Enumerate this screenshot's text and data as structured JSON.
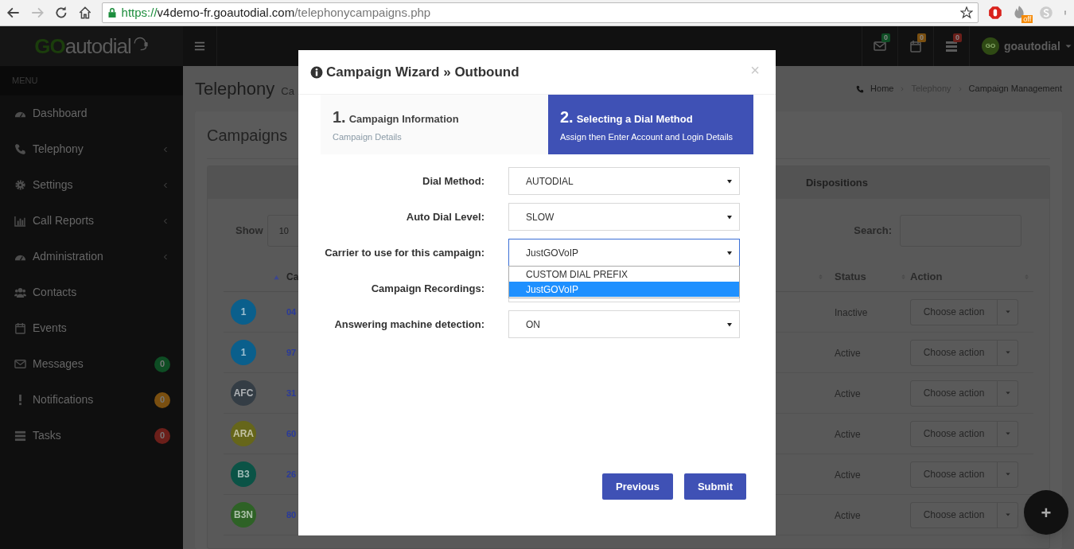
{
  "browser": {
    "url": {
      "scheme": "https://",
      "host": "v4demo-fr.goautodial.com",
      "path": "/telephonycampaigns.php"
    },
    "extension_badge": "off"
  },
  "header": {
    "logo": {
      "part_1": "GO",
      "part_2": "autodial"
    },
    "notifications": [
      {
        "kind": "mail",
        "count": "0",
        "color": "#0e4d24"
      },
      {
        "kind": "calendar",
        "count": "0",
        "color": "#7a4f10"
      },
      {
        "kind": "tasks",
        "count": "0",
        "color": "#6b1f1a"
      }
    ],
    "user": {
      "avatar": "GO",
      "name": "goautodial"
    }
  },
  "sidebar": {
    "heading": "MENU",
    "items": [
      {
        "kind": "dashboard",
        "label": "Dashboard",
        "expandable": false
      },
      {
        "kind": "phone",
        "label": "Telephony",
        "expandable": true
      },
      {
        "kind": "gear",
        "label": "Settings",
        "expandable": true
      },
      {
        "kind": "chart",
        "label": "Call Reports",
        "expandable": true
      },
      {
        "kind": "dashboard",
        "label": "Administration",
        "expandable": true
      },
      {
        "kind": "users",
        "label": "Contacts",
        "expandable": false
      },
      {
        "kind": "calendar",
        "label": "Events",
        "expandable": false
      },
      {
        "kind": "mail",
        "label": "Messages",
        "expandable": false,
        "badge": "0",
        "color": "#0e4d24"
      },
      {
        "kind": "exclamation",
        "label": "Notifications",
        "expandable": false,
        "badge": "0",
        "color": "#7a4f10"
      },
      {
        "kind": "tasks",
        "label": "Tasks",
        "expandable": false,
        "badge": "0",
        "color": "#6b1f1a"
      }
    ]
  },
  "page": {
    "title": "Telephony",
    "subtitle": "Ca",
    "breadcrumb": [
      "Home",
      "Telephony",
      "Campaign Management"
    ]
  },
  "card": {
    "title": "Campaigns",
    "tab": "Dispositions",
    "show_label": "Show",
    "show_value": "10",
    "search_label": "Search:",
    "columns": [
      {
        "label": "Ca",
        "sorted": true
      },
      {
        "label": "Status",
        "sorted": false
      },
      {
        "label": "Action",
        "sorted": false
      }
    ],
    "rows": [
      {
        "avatar": "1",
        "color": "#0a5f8c",
        "id": "04",
        "status": "Inactive",
        "action": "Choose action"
      },
      {
        "avatar": "1",
        "color": "#0a5f8c",
        "id": "97",
        "status": "Active",
        "action": "Choose action"
      },
      {
        "avatar": "AFC",
        "color": "#343d45",
        "id": "31",
        "status": "Active",
        "action": "Choose action"
      },
      {
        "avatar": "ARA",
        "color": "#66661a",
        "id": "60",
        "status": "Active",
        "action": "Choose action"
      },
      {
        "avatar": "B3",
        "color": "#0b5346",
        "id": "26",
        "status": "Active",
        "action": "Choose action"
      },
      {
        "avatar": "B3N",
        "color": "#2e6226",
        "id": "80",
        "status": "Active",
        "action": "Choose action"
      }
    ]
  },
  "modal": {
    "title": "Campaign Wizard » Outbound",
    "close": "×",
    "steps": [
      {
        "number": "1.",
        "title": "Campaign Information",
        "subtitle": "Campaign Details",
        "selected": false
      },
      {
        "number": "2.",
        "title": "Selecting a Dial Method",
        "subtitle": "Assign then Enter Account and Login Details",
        "selected": true
      }
    ],
    "fields": [
      {
        "label": "Dial Method:",
        "value": "AUTODIAL",
        "expanded": false
      },
      {
        "label": "Auto Dial Level:",
        "value": "SLOW",
        "expanded": false
      },
      {
        "label": "Carrier to use for this campaign:",
        "value": "JustGOVoIP",
        "expanded": true,
        "options": [
          {
            "label": "CUSTOM DIAL PREFIX",
            "selected": false
          },
          {
            "label": "JustGOVoIP",
            "selected": true
          }
        ]
      },
      {
        "label": "Campaign Recordings:",
        "expanded": false
      },
      {
        "label": "Answering machine detection:",
        "value": "ON",
        "expanded": false
      }
    ],
    "buttons": [
      "Previous",
      "Submit"
    ]
  },
  "fab": "+"
}
